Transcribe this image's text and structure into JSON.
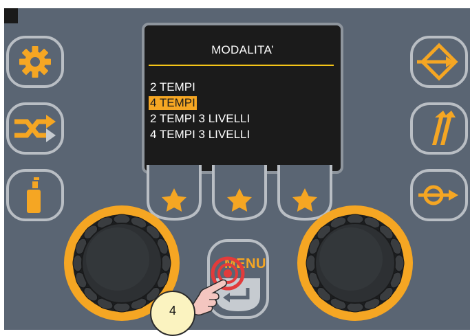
{
  "screen": {
    "title": "MODALITA’",
    "items": [
      {
        "label": "2 TEMPI",
        "selected": false
      },
      {
        "label": "4 TEMPI",
        "selected": true
      },
      {
        "label": "2 TEMPI 3 LIVELLI",
        "selected": false
      },
      {
        "label": "4 TEMPI 3 LIVELLI",
        "selected": false
      }
    ]
  },
  "colors": {
    "panel": "#5a6573",
    "accent": "#f5a623",
    "highlight": "#f5c518",
    "button_border": "#b9bec4",
    "knob_body": "#2d3033"
  },
  "left_buttons": [
    "gear-icon",
    "shuffle-icon",
    "spray-can-icon"
  ],
  "right_buttons": [
    "diamond-arrow-icon",
    "double-arrow-icon",
    "wire-feed-icon"
  ],
  "soft_keys": [
    "star-icon",
    "star-icon",
    "star-icon"
  ],
  "menu_button": {
    "label": "MENU"
  },
  "callout": {
    "number": "4"
  }
}
